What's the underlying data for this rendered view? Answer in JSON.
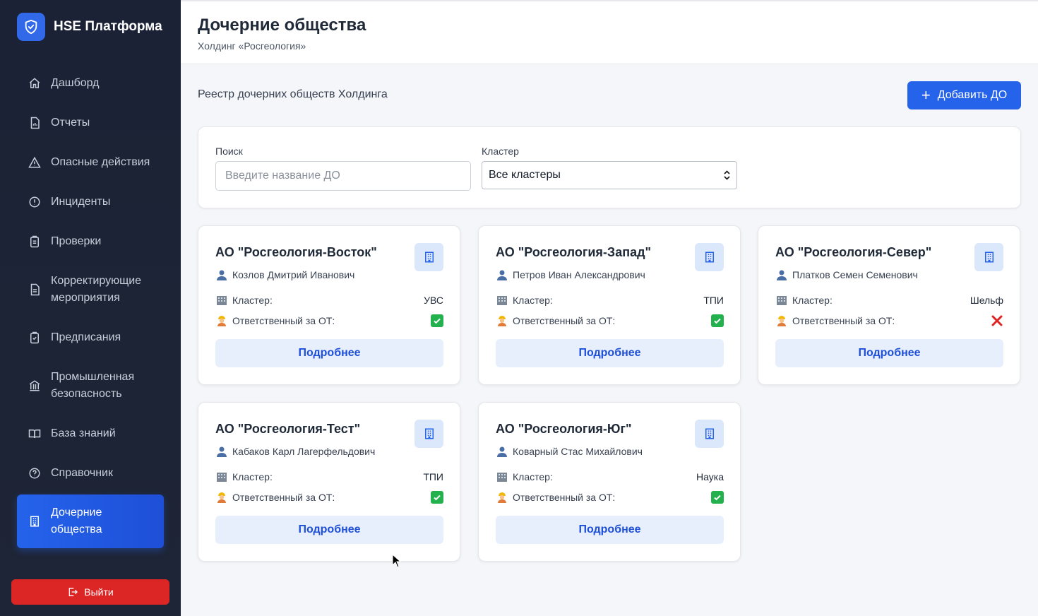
{
  "app": {
    "name": "HSE Платформа",
    "logout_label": "Выйти"
  },
  "sidebar": {
    "items": [
      {
        "label": "Дашборд",
        "icon": "home-icon"
      },
      {
        "label": "Отчеты",
        "icon": "report-icon"
      },
      {
        "label": "Опасные действия",
        "icon": "warning-icon"
      },
      {
        "label": "Инциденты",
        "icon": "alert-circle-icon"
      },
      {
        "label": "Проверки",
        "icon": "clipboard-icon"
      },
      {
        "label": "Корректирующие мероприятия",
        "icon": "document-icon"
      },
      {
        "label": "Предписания",
        "icon": "clipboard-check-icon"
      },
      {
        "label": "Промышленная безопасность",
        "icon": "bank-icon"
      },
      {
        "label": "База знаний",
        "icon": "book-icon"
      },
      {
        "label": "Справочник",
        "icon": "help-icon"
      },
      {
        "label": "Дочерние общества",
        "icon": "building-icon",
        "active": true
      }
    ]
  },
  "header": {
    "title": "Дочерние общества",
    "subtitle": "Холдинг «Росгеология»"
  },
  "main": {
    "registry_title": "Реестр дочерних обществ Холдинга",
    "add_button": "Добавить ДО",
    "filters": {
      "search_label": "Поиск",
      "search_placeholder": "Введите название ДО",
      "search_value": "",
      "cluster_label": "Кластер",
      "cluster_value": "Все кластеры"
    }
  },
  "cards": [
    {
      "title": "АО \"Росгеология-Восток\"",
      "person": "Козлов Дмитрий Иванович",
      "cluster_label": "Кластер:",
      "cluster": "УВС",
      "responsible_label": "Ответственный за ОТ:",
      "responsible": true,
      "button": "Подробнее"
    },
    {
      "title": "АО \"Росгеология-Запад\"",
      "person": "Петров Иван Александрович",
      "cluster_label": "Кластер:",
      "cluster": "ТПИ",
      "responsible_label": "Ответственный за ОТ:",
      "responsible": true,
      "button": "Подробнее"
    },
    {
      "title": "АО \"Росгеология-Север\"",
      "person": "Платков Семен Семенович",
      "cluster_label": "Кластер:",
      "cluster": "Шельф",
      "responsible_label": "Ответственный за ОТ:",
      "responsible": false,
      "button": "Подробнее"
    },
    {
      "title": "АО \"Росгеология-Тест\"",
      "person": "Кабаков Карл Лагерфельдович",
      "cluster_label": "Кластер:",
      "cluster": "ТПИ",
      "responsible_label": "Ответственный за ОТ:",
      "responsible": true,
      "button": "Подробнее"
    },
    {
      "title": "АО \"Росгеология-Юг\"",
      "person": "Коварный Стас Михайлович",
      "cluster_label": "Кластер:",
      "cluster": "Наука",
      "responsible_label": "Ответственный за ОТ:",
      "responsible": true,
      "button": "Подробнее"
    }
  ],
  "colors": {
    "sidebar_bg": "#1b2235",
    "accent": "#2563eb",
    "danger": "#dc2626",
    "success": "#22b14c"
  }
}
